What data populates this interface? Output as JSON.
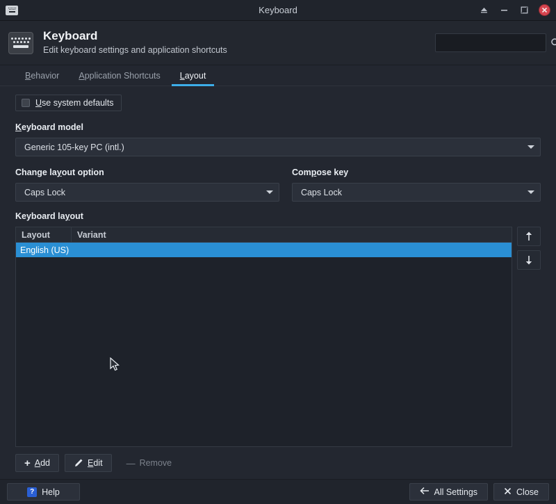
{
  "titlebar": {
    "title": "Keyboard",
    "app_icon": "keyboard-icon",
    "buttons": [
      {
        "name": "shade-button",
        "glyph": "shade"
      },
      {
        "name": "minimize-button",
        "glyph": "minimize"
      },
      {
        "name": "maximize-button",
        "glyph": "maximize"
      },
      {
        "name": "close-button",
        "glyph": "close"
      }
    ]
  },
  "header": {
    "icon": "keyboard-icon",
    "title": "Keyboard",
    "subtitle": "Edit keyboard settings and application shortcuts",
    "search": {
      "value": "",
      "placeholder": "",
      "icon": "search-icon"
    }
  },
  "tabs": [
    {
      "label": "Behavior",
      "mnemonic": "B",
      "active": false
    },
    {
      "label": "Application Shortcuts",
      "mnemonic": "A",
      "active": false
    },
    {
      "label": "Layout",
      "mnemonic": "L",
      "active": true
    }
  ],
  "tab_labels": {
    "behavior": "Behavior",
    "application_shortcuts": "Application Shortcuts",
    "layout": "Layout"
  },
  "layout_tab": {
    "use_system_defaults": {
      "label_pre": "",
      "label_mnemonic": "U",
      "label_post": "se system defaults",
      "checked": false
    },
    "keyboard_model": {
      "label_mnemonic": "K",
      "label_post": "eyboard model",
      "value": "Generic 105-key PC (intl.)"
    },
    "change_layout_option": {
      "label_pre": "Change la",
      "label_mnemonic": "y",
      "label_post": "out option",
      "value": "Caps Lock"
    },
    "compose_key": {
      "label_pre": "Com",
      "label_mnemonic": "p",
      "label_post": "ose key",
      "value": "Caps Lock"
    },
    "keyboard_layout": {
      "label_pre": "Keyboard la",
      "label_mnemonic": "y",
      "label_post": "out",
      "columns": [
        "Layout",
        "Variant"
      ],
      "rows": [
        {
          "layout": "English (US)",
          "variant": "",
          "selected": true
        }
      ],
      "move_up": "move-up-icon",
      "move_down": "move-down-icon"
    },
    "actions": [
      {
        "name": "add-button",
        "icon": "plus-icon",
        "label_mnemonic": "A",
        "label_post": "dd",
        "enabled": true
      },
      {
        "name": "edit-button",
        "icon": "pencil-icon",
        "label_pre": "",
        "label_mnemonic": "E",
        "label_post": "dit",
        "enabled": true
      },
      {
        "name": "remove-button",
        "icon": "minus-icon",
        "label_mnemonic": "R",
        "label_post": "emove",
        "enabled": false
      }
    ],
    "add_label": "Add",
    "edit_label": "Edit",
    "remove_label": "Remove"
  },
  "footer": {
    "help": "Help",
    "help_icon": "question-mark-icon",
    "all_settings": "All Settings",
    "all_settings_icon": "back-arrow-icon",
    "close": "Close",
    "close_icon": "x-icon"
  },
  "colors": {
    "accent": "#3daee9",
    "selection": "#2a8fd4",
    "close_red": "#d64550",
    "window_bg": "#232730",
    "titlebar_bg": "#20242c",
    "help_blue": "#2a5fd4"
  }
}
